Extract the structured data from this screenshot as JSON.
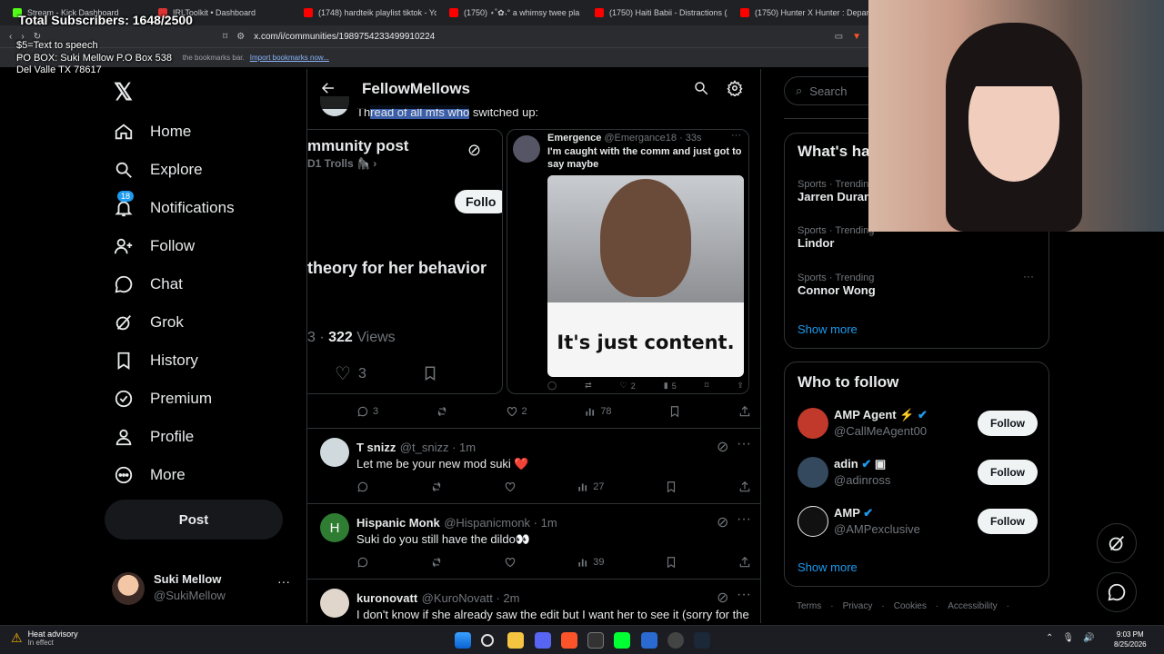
{
  "browser": {
    "tabs": [
      {
        "label": "Stream - Kick Dashboard",
        "color": "#53fc18"
      },
      {
        "label": "IRLToolkit • Dashboard",
        "color": "#d33"
      },
      {
        "label": "(1748) hardteik playlist tiktok - You",
        "color": "#f00"
      },
      {
        "label": "(1750) ⋆˚✿˖° a whimsy twee pla",
        "color": "#f00"
      },
      {
        "label": "(1750) Haiti Babii - Distractions (Au",
        "color": "#f00"
      },
      {
        "label": "(1750) Hunter X Hunter : Departure",
        "color": "#f00"
      }
    ],
    "url": "x.com/i/communities/1989754233499910224",
    "bookmarks_text": "the bookmarks bar.",
    "bookmarks_link": "Import bookmarks now..."
  },
  "overlay": {
    "subscribers": "Total Subscribers: 1648/2500",
    "tts": "$5=Text to speech",
    "po_box_line1": "PO BOX: Suki Mellow P.O Box 538",
    "po_box_line2": "Del Valle TX 78617"
  },
  "nav": {
    "items": [
      {
        "label": "Home",
        "icon": "home-icon"
      },
      {
        "label": "Explore",
        "icon": "search-icon"
      },
      {
        "label": "Notifications",
        "icon": "bell-icon",
        "badge": "18"
      },
      {
        "label": "Follow",
        "icon": "person-plus-icon"
      },
      {
        "label": "Chat",
        "icon": "chat-icon"
      },
      {
        "label": "Grok",
        "icon": "grok-icon"
      },
      {
        "label": "History",
        "icon": "bookmark-icon"
      },
      {
        "label": "Premium",
        "icon": "verified-icon"
      },
      {
        "label": "Profile",
        "icon": "person-icon"
      },
      {
        "label": "More",
        "icon": "more-circle-icon"
      }
    ],
    "post_label": "Post",
    "account": {
      "name": "Suki Mellow",
      "handle": "@SukiMellow"
    }
  },
  "main": {
    "title": "FellowMellows",
    "thread_prefix": "Th",
    "thread_highlight": "read of all mfs who",
    "thread_rest": " switched up:",
    "card_left": {
      "heading": "mmunity post",
      "sub": "D1 Trolls 🦍 ›",
      "follow": "Follo",
      "body": "theory for her behavior",
      "views_num": "3 · ",
      "views_bold": "322",
      "views_label": " Views",
      "likes": "3"
    },
    "card_right": {
      "name": "Emergence",
      "handle": "@Emergance18 · 33s",
      "text": "I'm caught with the comm and just got to say maybe",
      "caption": "It's just content.",
      "likes": "2",
      "views": "5"
    },
    "first_actions": {
      "replies": "3",
      "likes": "2",
      "views": "78"
    },
    "tweets": [
      {
        "name": "T snizz",
        "handle": "@t_snizz · 1m",
        "text": "Let me be your new mod suki ❤️",
        "views": "27",
        "avatar_color": "#cfd9de",
        "initial": ""
      },
      {
        "name": "Hispanic Monk",
        "handle": "@Hispanicmonk · 1m",
        "text": "Suki do you still have the dildo👀",
        "views": "39",
        "avatar_color": "#2e7d32",
        "initial": "H"
      },
      {
        "name": "kuronovatt",
        "handle": "@KuroNovatt · 2m",
        "text": "I don't know if she already saw the edit but I want her to see it (sorry for the",
        "views": "",
        "avatar_color": "#e0d6cc",
        "initial": ""
      }
    ]
  },
  "right": {
    "search_placeholder": "Search",
    "trends_title": "What's ha",
    "trends": [
      {
        "category": "Sports · Trending",
        "name": "Jarren Duran"
      },
      {
        "category": "Sports · Trending",
        "name": "Lindor"
      },
      {
        "category": "Sports · Trending",
        "name": "Connor Wong"
      }
    ],
    "show_more": "Show more",
    "wtf_title": "Who to follow",
    "wtf": [
      {
        "name": "AMP Agent ⚡",
        "handle": "@CallMeAgent00",
        "avatar_color": "#c0392b"
      },
      {
        "name": "adin",
        "handle": "@adinross",
        "avatar_color": "#34495e"
      },
      {
        "name": "AMP",
        "handle": "@AMPexclusive",
        "avatar_color": "#111"
      }
    ],
    "follow_label": "Follow",
    "footer": [
      "Terms",
      "Privacy",
      "Cookies",
      "Accessibility"
    ]
  },
  "taskbar": {
    "weather_title": "Heat advisory",
    "weather_sub": "In effect",
    "time": "9:03 PM",
    "date": "8/25/2026"
  },
  "colors": {
    "accent": "#1d9bf0",
    "bg": "#000000",
    "border": "#2f3336",
    "muted": "#71767b"
  }
}
